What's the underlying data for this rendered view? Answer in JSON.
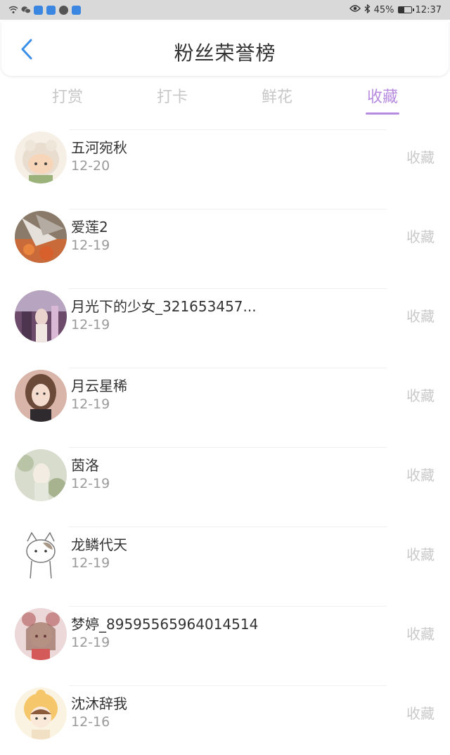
{
  "statusbar": {
    "battery": "45%",
    "battery_level": 0.45,
    "time": "12:37",
    "icons": [
      "wifi-icon",
      "wechat-icon",
      "app-icon",
      "app-icon",
      "avatar-icon",
      "search-icon",
      "eye-icon",
      "bluetooth-icon",
      "battery-icon"
    ]
  },
  "header": {
    "title": "粉丝荣誉榜",
    "back_icon": "chevron-left-icon"
  },
  "tabs": [
    {
      "label": "打赏",
      "active": false
    },
    {
      "label": "打卡",
      "active": false
    },
    {
      "label": "鲜花",
      "active": false
    },
    {
      "label": "收藏",
      "active": true
    }
  ],
  "colors": {
    "accent": "#b78be0",
    "back_arrow": "#3a8fe8",
    "inactive_tab": "#c7c7c7"
  },
  "fans": [
    {
      "name": "五河宛秋",
      "date": "12-20",
      "type": "收藏"
    },
    {
      "name": "爱莲2",
      "date": "12-19",
      "type": "收藏"
    },
    {
      "name": "月光下的少女_321653457...",
      "date": "12-19",
      "type": "收藏"
    },
    {
      "name": "月云星稀",
      "date": "12-19",
      "type": "收藏"
    },
    {
      "name": "茵洛",
      "date": "12-19",
      "type": "收藏"
    },
    {
      "name": "龙鳞代天",
      "date": "12-19",
      "type": "收藏"
    },
    {
      "name": "梦婷_89595565964014514",
      "date": "12-19",
      "type": "收藏"
    },
    {
      "name": "沈沐辞我",
      "date": "12-16",
      "type": "收藏"
    }
  ]
}
